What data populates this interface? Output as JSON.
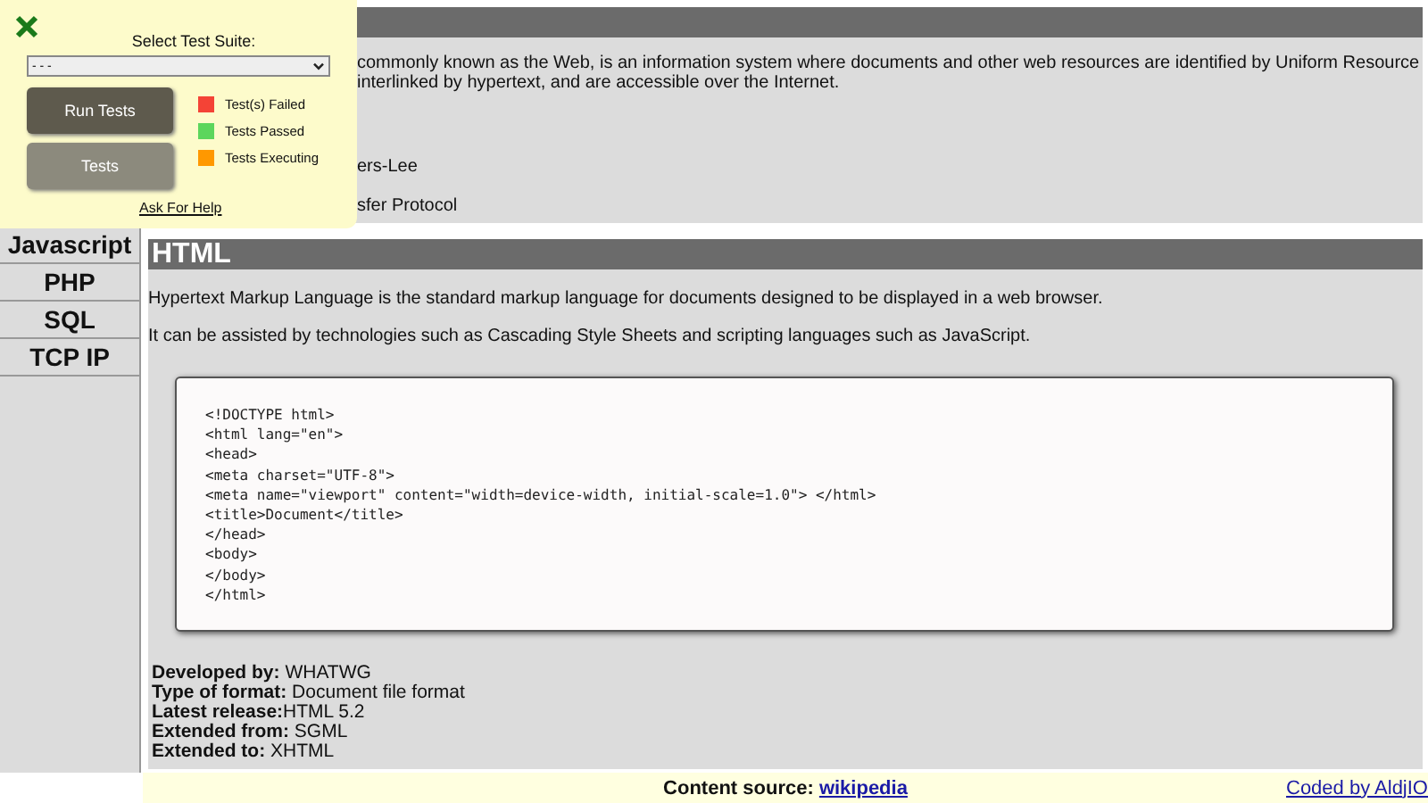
{
  "sidebar": {
    "items": [
      {
        "label": "Javascript"
      },
      {
        "label": "PHP"
      },
      {
        "label": "SQL"
      },
      {
        "label": "TCP IP"
      }
    ]
  },
  "www_section": {
    "lines": [
      "commonly known as the Web, is an information system where documents and other web resources are identified by Uniform Resource",
      "interlinked by hypertext, and are accessible over the Internet.",
      "ers-Lee",
      "sfer Protocol"
    ]
  },
  "html_section": {
    "title": "HTML",
    "paragraphs": [
      "Hypertext Markup Language is the standard markup language for documents designed to be displayed in a web browser.",
      "It can be assisted by technologies such as Cascading Style Sheets and scripting languages such as JavaScript."
    ],
    "code": [
      "<!DOCTYPE html>",
      "<html lang=\"en\">",
      "<head>",
      "<meta charset=\"UTF-8\">",
      "<meta name=\"viewport\" content=\"width=device-width, initial-scale=1.0\"> </html>",
      "<title>Document</title>",
      "</head>",
      "<body>",
      "</body>",
      "</html>"
    ],
    "facts": [
      "**Developed by:** WHATWG",
      "**Type of format:** Document file format",
      "**Latest release:**HTML 5.2",
      "**Extended from:** SGML",
      "**Extended to:** XHTML"
    ]
  },
  "test_panel": {
    "label": "Select Test Suite:",
    "select_value": "- - -",
    "buttons": [
      "Run Tests",
      "Tests"
    ],
    "legend": [
      {
        "label": "Test(s) Failed",
        "color": "#f44336"
      },
      {
        "label": "Tests Passed",
        "color": "#5cd65c"
      },
      {
        "label": "Tests Executing",
        "color": "#ff9800"
      }
    ],
    "help_link": "Ask For Help"
  },
  "footer": {
    "source_label": "Content source:",
    "source_link": "wikipedia",
    "credit": "Coded by AldjIO"
  }
}
